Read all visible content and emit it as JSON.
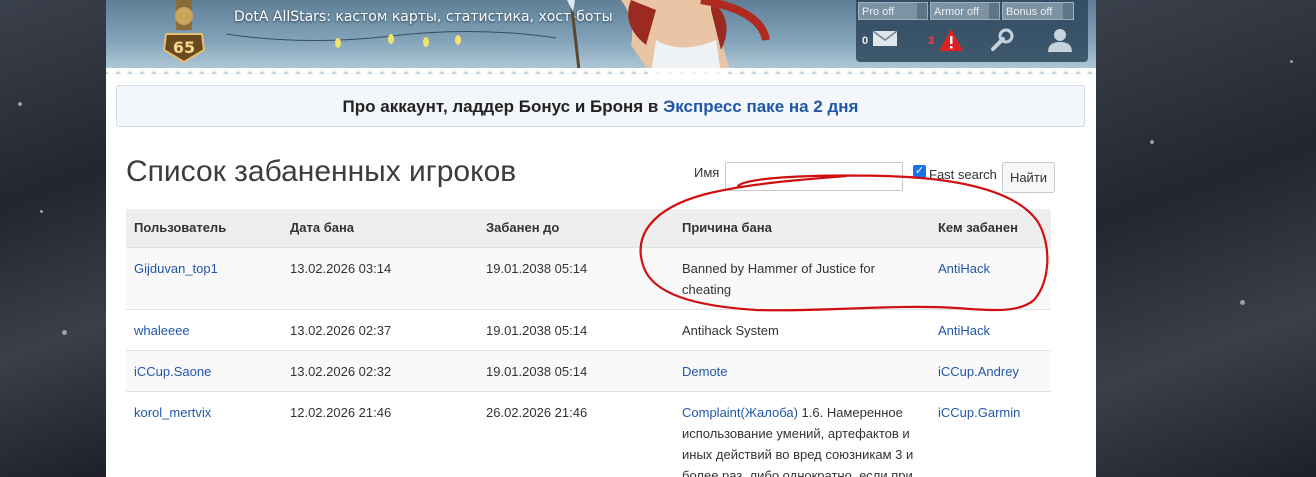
{
  "header": {
    "tagline": "DotA AllStars: кастом карты, статистика, хост-боты",
    "level_badge": "65",
    "toggles": [
      "Pro off",
      "Armor off",
      "Bonus off"
    ],
    "messages_count": "0",
    "alerts_count": "3",
    "icons": [
      "mail-icon",
      "warning-icon",
      "wrench-icon",
      "user-icon"
    ]
  },
  "promo": {
    "text": "Про аккаунт, ладдер Бонус и Броня в ",
    "link": "Экспресс паке на 2 дня"
  },
  "page": {
    "title": "Список забаненных игроков"
  },
  "search": {
    "label": "Имя",
    "value": "",
    "fast_search_label": "Fast search",
    "fast_search_checked": true,
    "button": "Найти"
  },
  "table": {
    "headers": [
      "Пользователь",
      "Дата бана",
      "Забанен до",
      "Причина бана",
      "Кем забанен"
    ],
    "rows": [
      {
        "user": "Gijduvan_top1",
        "date": "13.02.2026 03:14",
        "until": "19.01.2038 05:14",
        "reason_link": "",
        "reason": "Banned by Hammer of Justice for cheating",
        "by": "AntiHack"
      },
      {
        "user": "whaleeee",
        "date": "13.02.2026 02:37",
        "until": "19.01.2038 05:14",
        "reason_link": "",
        "reason": "Antihack System",
        "by": "AntiHack"
      },
      {
        "user": "iCCup.Saone",
        "date": "13.02.2026 02:32",
        "until": "19.01.2038 05:14",
        "reason_link": "Demote",
        "reason": "",
        "by": "iCCup.Andrey"
      },
      {
        "user": "korol_mertvix",
        "date": "12.02.2026 21:46",
        "until": "26.02.2026 21:46",
        "reason_link": "Complaint(Жалоба)",
        "reason": " 1.6. Намеренное использование умений, артефактов и иных действий во вред союзникам 3 и более раз, либо однократно, если при",
        "by": "iCCup.Garmin"
      }
    ]
  },
  "colors": {
    "link": "#2157a8",
    "annotation": "#d01010",
    "header_bg": "#6f8fa6"
  }
}
